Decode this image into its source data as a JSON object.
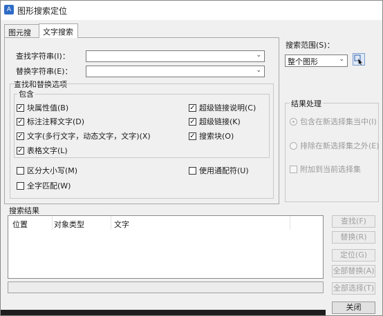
{
  "window": {
    "title": "图形搜索定位",
    "app_icon": "A"
  },
  "tabs": [
    {
      "label": "图元搜索"
    },
    {
      "label": "文字搜索"
    }
  ],
  "find": {
    "label": "查找字符串(I)：",
    "value": ""
  },
  "replace": {
    "label": "替换字符串(E)：",
    "value": ""
  },
  "options_group": {
    "title": "查找和替换选项",
    "include_title": "包含",
    "include_left": [
      {
        "label": "块属性值(B)",
        "checked": true
      },
      {
        "label": "标注注释文字(D)",
        "checked": true
      },
      {
        "label": "文字(多行文字，动态文字，文字)(X)",
        "checked": true
      },
      {
        "label": "表格文字(L)",
        "checked": true
      }
    ],
    "include_right": [
      {
        "label": "超级链接说明(C)",
        "checked": true
      },
      {
        "label": "超级链接(K)",
        "checked": true
      },
      {
        "label": "搜索块(O)",
        "checked": true
      }
    ],
    "match_case": {
      "label": "区分大小写(M)",
      "checked": false
    },
    "match_whole": {
      "label": "全字匹配(W)",
      "checked": false
    },
    "wildcards": {
      "label": "使用通配符(U)",
      "checked": false
    }
  },
  "scope": {
    "label": "搜索范围(S)：",
    "value": "整个图形"
  },
  "result_handling": {
    "title": "结果处理",
    "include_in_new": {
      "label": "包含在新选择集当中(I)",
      "selected": true
    },
    "exclude_from_new": {
      "label": "排除在新选择集之外(E)",
      "selected": false
    },
    "append_current": {
      "label": "附加到当前选择集",
      "checked": false
    }
  },
  "results": {
    "title": "搜索结果",
    "columns": [
      "位置",
      "对象类型",
      "文字"
    ],
    "rows": [],
    "status": ""
  },
  "buttons": {
    "find": "查找(F)",
    "replace": "替换(R)",
    "locate": "定位(G)",
    "replace_all": "全部替换(A)",
    "select_all": "全部选择(T)",
    "close": "关闭"
  }
}
